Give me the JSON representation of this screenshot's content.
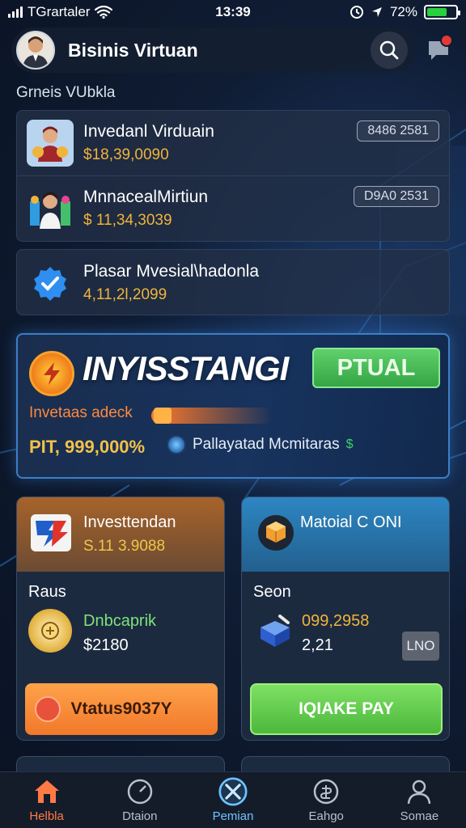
{
  "status_bar": {
    "carrier": "TGrartaler",
    "time": "13:39",
    "battery": "72%"
  },
  "header": {
    "title": "Bisinis Virtuan"
  },
  "section_label": "Grneis VUbkla",
  "list": [
    {
      "title": "Invedanl Virduain",
      "value": "$18,39,0090",
      "tag": "8486 2581"
    },
    {
      "title": "MnnacealMirtiun",
      "value": "$ 11,34,3039",
      "tag": "D9A0 2531"
    },
    {
      "title": "Plasar Mvesial\\hadonla",
      "value": "4,11,2l,2099"
    }
  ],
  "banner": {
    "title": "INYISSTANGI",
    "button_label": "PTUAL",
    "subtitle": "Invetaas adeck",
    "stat": "PIT, 999,000%",
    "info": "Pallayatad Mcmitaras",
    "info_suffix": "$"
  },
  "cards": [
    {
      "title": "Investtendan",
      "value": "S.11 3.9088",
      "label": "Raus",
      "main": "Dnbcaprik",
      "sub": "$2180",
      "button": "Vtatus9037Y"
    },
    {
      "title": "Matoial C ONI",
      "label": "Seon",
      "main": "099,2958",
      "sub": "2,21",
      "chip": "LNO",
      "button": "IQIAKE PAY"
    }
  ],
  "nav": [
    {
      "label": "Helbla"
    },
    {
      "label": "Dtaion"
    },
    {
      "label": "Pemian"
    },
    {
      "label": "Eahgo"
    },
    {
      "label": "Somae"
    }
  ],
  "colors": {
    "accent_orange": "#ff7a45",
    "gold": "#f0b43c",
    "green": "#4cb83d",
    "blue_glow": "#3c7fc7"
  }
}
